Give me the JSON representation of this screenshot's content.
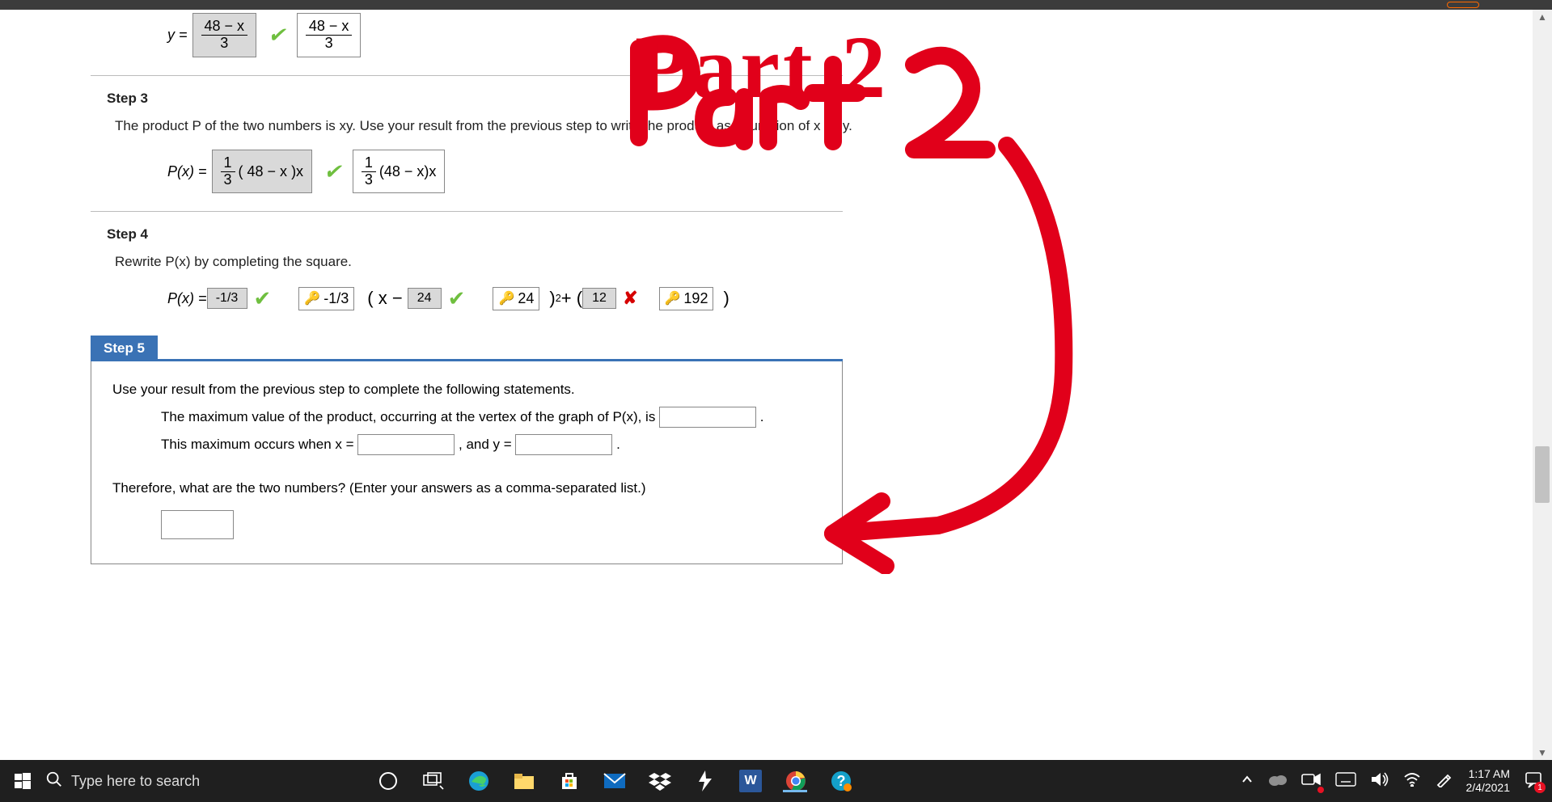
{
  "annotation": {
    "text": "Part 2"
  },
  "step2": {
    "lhs": "y =",
    "ans_num": "48 − x",
    "ans_den": "3",
    "disp_num": "48 − x",
    "disp_den": "3"
  },
  "step3": {
    "title": "Step 3",
    "text": "The product P of the two numbers is xy. Use your result from the previous step to write the product as a function of x only.",
    "lhs": "P(x) =",
    "ans_frac_num": "1",
    "ans_frac_den": "3",
    "ans_rest": "( 48 − x )x",
    "disp_frac_num": "1",
    "disp_frac_den": "3",
    "disp_rest": "(48 − x)x"
  },
  "step4": {
    "title": "Step 4",
    "text": "Rewrite P(x) by completing the square.",
    "lhs": "P(x) =",
    "v1": "-1/3",
    "v2": "-1/3",
    "t1": "( x −",
    "v3": "24",
    "v4": "24",
    "t2": ")",
    "sup": "2",
    "t3": " + (",
    "v5": "12",
    "v6": "192",
    "t4": ")"
  },
  "step5": {
    "tab": "Step 5",
    "line1": "Use your result from the previous step to complete the following statements.",
    "line2a": "The maximum value of the product, occurring at the vertex of the graph of P(x), is ",
    "line2b": " .",
    "line3a": "This maximum occurs when  x = ",
    "line3b": " ,  and y = ",
    "line3c": " .",
    "line4": "Therefore, what are the two numbers? (Enter your answers as a comma-separated list.)"
  },
  "taskbar": {
    "search_placeholder": "Type here to search",
    "time": "1:17 AM",
    "date": "2/4/2021",
    "notif_badge": "1"
  }
}
